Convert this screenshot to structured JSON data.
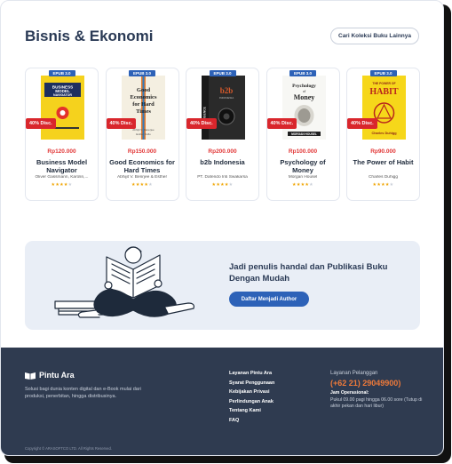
{
  "section": {
    "title": "Bisnis & Ekonomi",
    "more_label": "Cari Koleksi Buku Lainnya"
  },
  "books": [
    {
      "badge": "EPUB 3.0",
      "discount": "40% Disc.",
      "price": "Rp120.000",
      "title": "Business Model Navigator",
      "author": "Oliver Gassmann, Karolin,...",
      "rating": 4,
      "cover_text": "BUSINESS MODEL NAVIGATOR",
      "cover_color": "#f5d21d"
    },
    {
      "badge": "EPUB 3.0",
      "discount": "40% Disc.",
      "price": "Rp150.000",
      "title": "Good Economics for Hard Times",
      "author": "Abhijit V. Benrjee & Esther",
      "rating": 4,
      "cover_text": "Good Economics for Hard Times",
      "cover_color": "#f4efe1"
    },
    {
      "badge": "EPUB 3.0",
      "discount": "40% Disc.",
      "price": "Rp200.000",
      "title": "b2b Indonesia",
      "author": "PT. Dafendo Inti Swakarsa",
      "rating": 4,
      "cover_text": "b2b",
      "cover_color": "#2a2a2a"
    },
    {
      "badge": "EPUB 3.0",
      "discount": "40% Disc.",
      "price": "Rp100.000",
      "title": "Psychology of Money",
      "author": "Morgan Housel",
      "rating": 4,
      "cover_text": "Psychology of Money",
      "cover_color": "#f7f7f4"
    },
    {
      "badge": "EPUB 3.0",
      "discount": "40% Disc.",
      "price": "Rp90.000",
      "title": "The Power of Habit",
      "author": "Charles Duhigg",
      "rating": 4,
      "cover_text": "HABIT",
      "cover_color": "#f6d71a"
    }
  ],
  "banner": {
    "headline": "Jadi penulis handal dan Publikasi Buku Dengan Mudah",
    "cta": "Daftar Menjadi Author"
  },
  "footer": {
    "brand": "Pintu Ara",
    "description": "Solusi bagi dunia konten digital dan e-Book mulai dari produksi, penerbitan, hingga distribusinya.",
    "links": [
      "Layanan Pintu Ara",
      "Syarat Penggunaan",
      "Kebijakan Privasi",
      "Perlindungan Anak",
      "Tentang Kami",
      "FAQ"
    ],
    "cs_label": "Layanan Pelanggan",
    "cs_phone": "(+62 21) 29049900)",
    "cs_op_label": "Jam Operasional:",
    "cs_hours": "Pukul 09.00 pagi hingga 06.00 sore (Tutup di akhir pekan dan hari libur)",
    "copyright": "Copyright © ARASOFTCO LTD. All Rights Reserved."
  },
  "colors": {
    "accent": "#2d62b8",
    "discount": "#d9262c",
    "price": "#e23636",
    "footer_bg": "#2f3b50",
    "phone": "#ef7a3a"
  }
}
